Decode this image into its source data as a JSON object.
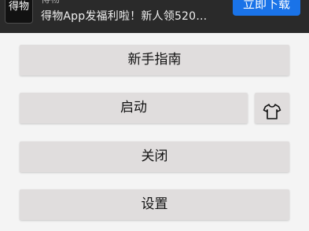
{
  "banner": {
    "logo_text": "得物",
    "title": "得物",
    "message": "得物App发福利啦！新人领520…",
    "download_label": "立即下载"
  },
  "menu": {
    "guide_label": "新手指南",
    "start_label": "启动",
    "close_label": "关闭",
    "settings_label": "设置"
  },
  "icons": {
    "skin": "tshirt-icon"
  }
}
